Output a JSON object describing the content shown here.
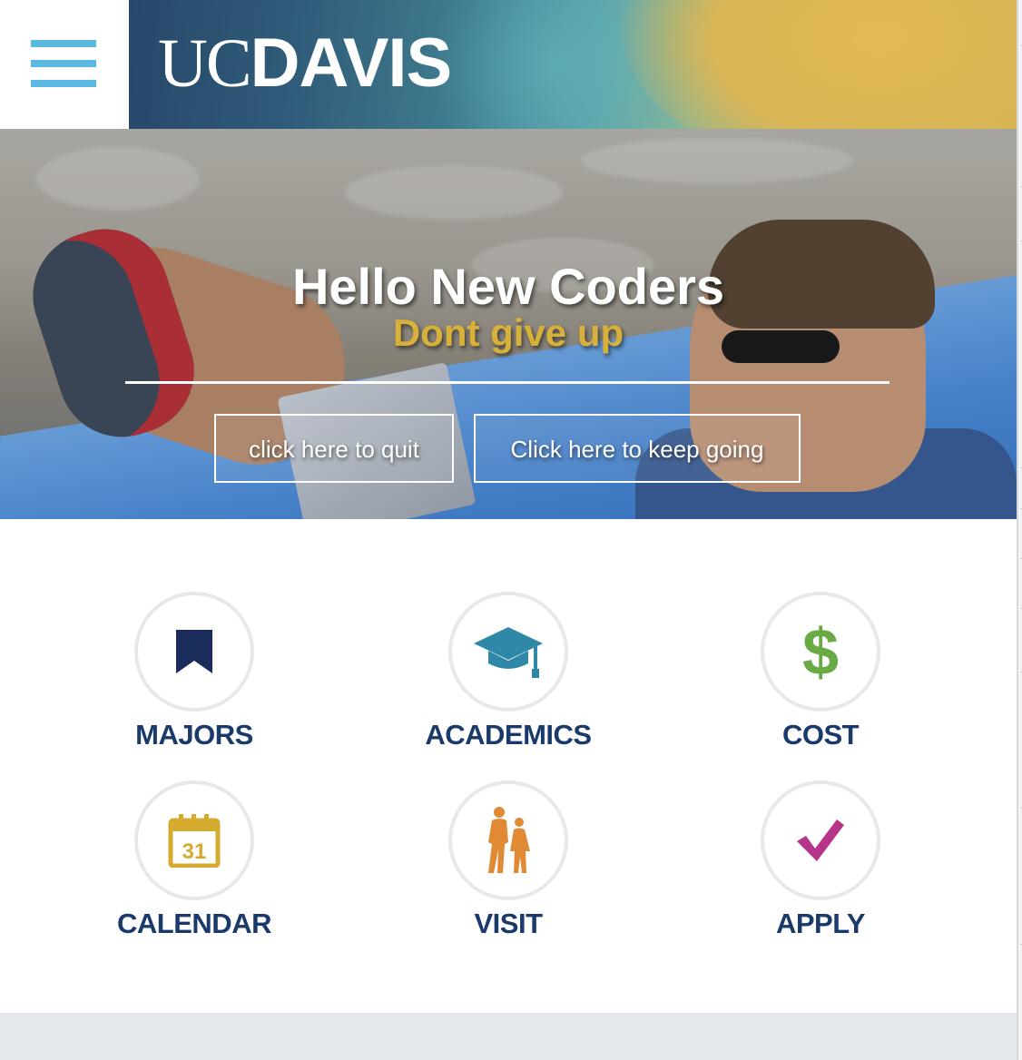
{
  "header": {
    "logo_uc": "UC",
    "logo_davis": "DAVIS",
    "menu_icon": "hamburger-menu-icon",
    "menu_color": "#5bb8e0"
  },
  "hero": {
    "title": "Hello New Coders",
    "subtitle": "Dont give up",
    "subtitle_color": "#d8b13a",
    "buttons": {
      "quit": "click here to quit",
      "keep_going": "Click here to keep going"
    }
  },
  "quick_links": [
    {
      "label": "MAJORS",
      "icon": "bookmark-icon",
      "color": "#1a2c5b"
    },
    {
      "label": "ACADEMICS",
      "icon": "graduation-cap-icon",
      "color": "#2f89a6"
    },
    {
      "label": "COST",
      "icon": "dollar-icon",
      "color": "#6aaa45"
    },
    {
      "label": "CALENDAR",
      "icon": "calendar-icon",
      "color": "#d4ab2e",
      "icon_text": "31"
    },
    {
      "label": "VISIT",
      "icon": "people-walking-icon",
      "color": "#e08a35"
    },
    {
      "label": "APPLY",
      "icon": "checkmark-icon",
      "color": "#b8338a"
    }
  ],
  "colors": {
    "link_label": "#1a3a6b",
    "circle_border": "#e6e8ec",
    "footer": "#e5e8ec"
  }
}
